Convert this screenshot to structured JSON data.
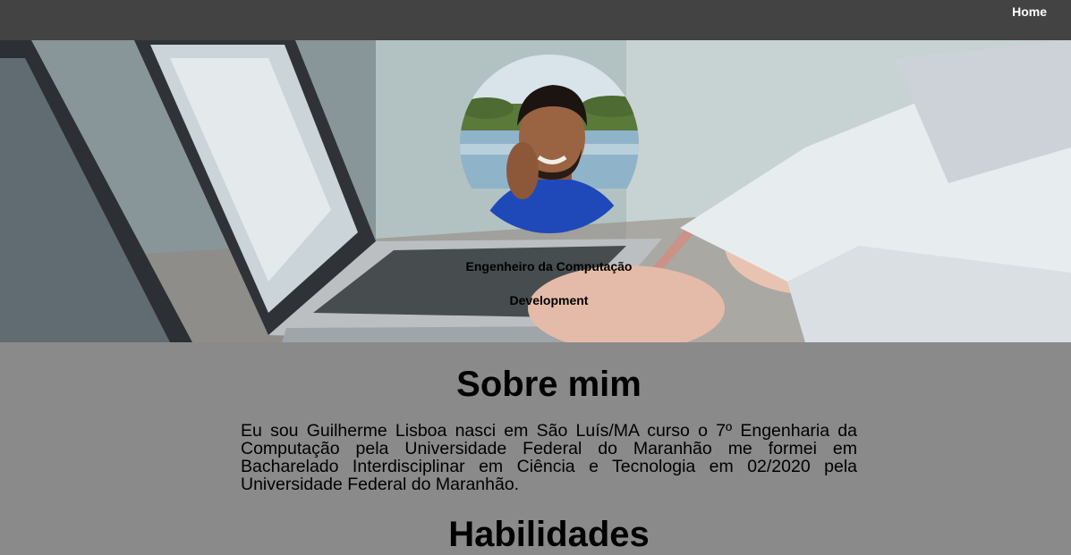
{
  "nav": {
    "home_label": "Home"
  },
  "hero": {
    "role": "Engenheiro da Computação",
    "subtitle": "Development"
  },
  "about": {
    "title": "Sobre mim",
    "text": "Eu sou Guilherme Lisboa nasci em São Luís/MA curso o 7º Engenharia da Computação pela Universidade Federal do Maranhão me formei em Bacharelado Interdisciplinar em Ciência e Tecnologia em 02/2020 pela Universidade Federal do Maranhão."
  },
  "skills": {
    "title": "Habilidades"
  },
  "colors": {
    "navbar": "#434343",
    "page_background": "#8a8a8a",
    "nav_text": "#ffffff"
  }
}
